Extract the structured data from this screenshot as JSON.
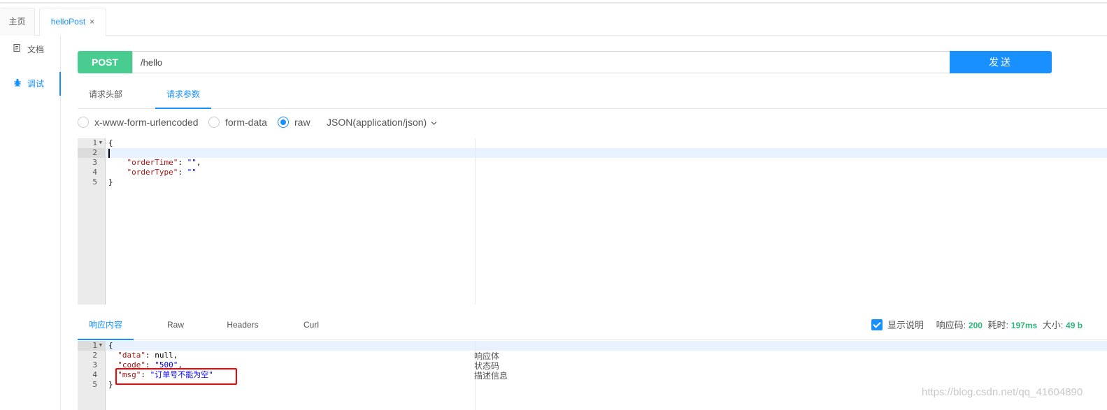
{
  "tabs": {
    "home": "主页",
    "active": "helloPost",
    "close": "×"
  },
  "sidebar": {
    "items": [
      {
        "label": "文档",
        "icon": "document-icon"
      },
      {
        "label": "调试",
        "icon": "bug-icon"
      }
    ]
  },
  "request": {
    "method": "POST",
    "url": "/hello",
    "send_label": "发送"
  },
  "request_tabs": [
    "请求头部",
    "请求参数"
  ],
  "body_types": {
    "options": [
      "x-www-form-urlencoded",
      "form-data",
      "raw"
    ],
    "selected": "raw",
    "content_type": "JSON(application/json)"
  },
  "request_editor": {
    "line_numbers": [
      "1",
      "2",
      "3",
      "4",
      "5"
    ],
    "lines": [
      "{",
      "",
      "    \"orderTime\": \"\",",
      "    \"orderType\": \"\"",
      "}"
    ]
  },
  "response_tabs": [
    "响应内容",
    "Raw",
    "Headers",
    "Curl"
  ],
  "response_info": {
    "show_desc_label": "显示说明",
    "code_label": "响应码:",
    "code": "200",
    "time_label": "耗时:",
    "time": "197ms",
    "size_label": "大小:",
    "size": "49 b"
  },
  "response_editor": {
    "line_numbers": [
      "1",
      "2",
      "3",
      "4",
      "5"
    ],
    "lines": [
      "{",
      "  \"data\": null,",
      "  \"code\": \"500\",",
      "  \"msg\": \"订单号不能为空\"",
      "}"
    ],
    "notes": [
      "响应体",
      "状态码",
      "描述信息"
    ]
  },
  "watermark": "https://blog.csdn.net/qq_41604890",
  "colors": {
    "accent": "#1890ff",
    "method": "#49cc90",
    "success": "#2fb37a",
    "highlight_box": "#ff0000"
  }
}
